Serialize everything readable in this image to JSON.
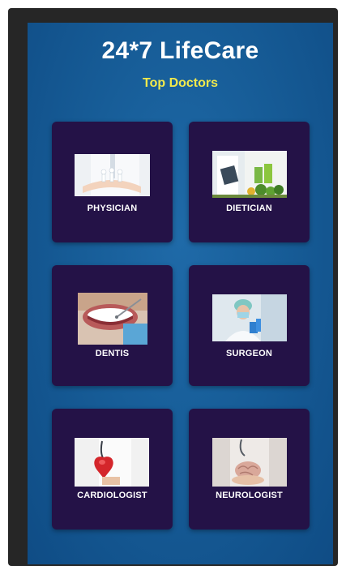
{
  "header": {
    "app_title": "24*7 LifeCare",
    "subtitle": "Top Doctors"
  },
  "doctors": [
    {
      "label": "PHYSICIAN",
      "icon": "physician-image"
    },
    {
      "label": "DIETICIAN",
      "icon": "dietician-image"
    },
    {
      "label": "DENTIS",
      "icon": "dentist-image"
    },
    {
      "label": "SURGEON",
      "icon": "surgeon-image"
    },
    {
      "label": "CARDIOLOGIST",
      "icon": "cardiologist-image"
    },
    {
      "label": "NEUROLOGIST",
      "icon": "neurologist-image"
    }
  ],
  "colors": {
    "background": "#175d98",
    "card": "#241247",
    "title": "#ffffff",
    "subtitle": "#f1e94c"
  }
}
